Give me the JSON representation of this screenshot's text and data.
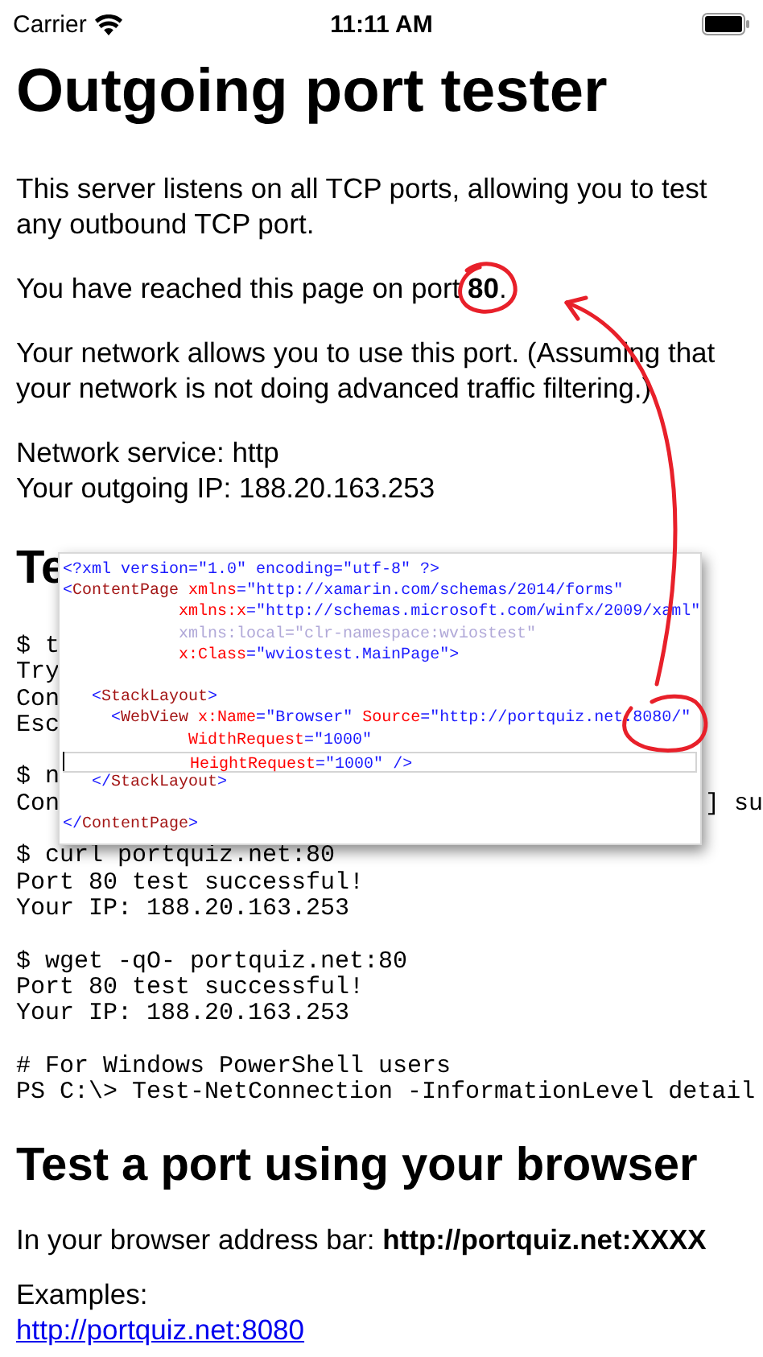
{
  "status_bar": {
    "carrier": "Carrier",
    "time": "11:11 AM"
  },
  "title": "Outgoing port tester",
  "intro": [
    "This server listens on all TCP ports, allowing you to test any outbound TCP port.",
    "You have reached this page on port **80**.",
    "Your network allows you to use this port. (Assuming that your network is not doing advanced traffic filtering.)"
  ],
  "info_lines": [
    "Network service: http",
    "Your outgoing IP: 188.20.163.253"
  ],
  "section_heading": "Te",
  "code_blocks": [
    [
      {
        "text": "$ t"
      },
      {
        "text": "Try"
      },
      {
        "text": "Con"
      },
      {
        "text": "Esc"
      }
    ],
    [
      {
        "text": "$ n"
      },
      {
        "text": "Con",
        "tail": "] su"
      }
    ],
    [
      {
        "text": "$ curl portquiz.net:80"
      },
      {
        "text": "Port 80 test successful!"
      },
      {
        "text": "Your IP: 188.20.163.253"
      }
    ],
    [
      {
        "text": "$ wget -qO- portquiz.net:80"
      },
      {
        "text": "Port 80 test successful!"
      },
      {
        "text": "Your IP: 188.20.163.253"
      }
    ],
    [
      {
        "text": "# For Windows PowerShell users"
      },
      {
        "text": "PS C:\\> Test-NetConnection -InformationLevel detail"
      }
    ]
  ],
  "browser_heading": "Test a port using your browser",
  "browser_hint": "In your browser address bar: **http://portquiz.net:XXXX**",
  "examples_label": "Examples:",
  "example_link": "http://portquiz.net:8080",
  "code_overlay": {
    "lines": [
      {
        "spaced": false,
        "current": false,
        "tokens": [
          {
            "kind": "punct",
            "text": "<?xml version=\"1.0\" encoding=\"utf-8\" ?>"
          }
        ]
      },
      {
        "spaced": false,
        "current": false,
        "tokens": [
          {
            "kind": "punct",
            "text": "<"
          },
          {
            "kind": "tag",
            "text": "ContentPage"
          },
          {
            "kind": "attr",
            "text": " xmlns"
          },
          {
            "kind": "punct",
            "text": "="
          },
          {
            "kind": "value",
            "text": "\"http://xamarin.com/schemas/2014/forms\""
          }
        ]
      },
      {
        "spaced": false,
        "current": false,
        "tokens": [
          {
            "kind": "attr",
            "text": "            xmlns:x"
          },
          {
            "kind": "punct",
            "text": "="
          },
          {
            "kind": "value",
            "text": "\"http://schemas.microsoft.com/winfx/2009/xaml\""
          }
        ]
      },
      {
        "spaced": false,
        "current": false,
        "tokens": [
          {
            "kind": "faded",
            "text": "            xmlns:local=\"clr-namespace:wviostest\""
          }
        ]
      },
      {
        "spaced": false,
        "current": false,
        "tokens": [
          {
            "kind": "attr",
            "text": "            x:Class"
          },
          {
            "kind": "punct",
            "text": "="
          },
          {
            "kind": "value",
            "text": "\"wviostest.MainPage\""
          },
          {
            "kind": "punct",
            "text": ">"
          }
        ]
      },
      {
        "spaced": true,
        "current": false,
        "tokens": [
          {
            "kind": "punct",
            "text": "   <"
          },
          {
            "kind": "tag",
            "text": "StackLayout"
          },
          {
            "kind": "punct",
            "text": ">"
          }
        ]
      },
      {
        "spaced": false,
        "current": false,
        "tokens": [
          {
            "kind": "punct",
            "text": "     <"
          },
          {
            "kind": "tag",
            "text": "WebView"
          },
          {
            "kind": "attr",
            "text": " x:Name"
          },
          {
            "kind": "punct",
            "text": "="
          },
          {
            "kind": "value",
            "text": "\"Browser\""
          },
          {
            "kind": "attr",
            "text": " Source"
          },
          {
            "kind": "punct",
            "text": "="
          },
          {
            "kind": "value",
            "text": "\"http://portquiz.net:8080/\""
          }
        ]
      },
      {
        "spaced": false,
        "current": false,
        "tokens": [
          {
            "kind": "attr",
            "text": "             WidthRequest"
          },
          {
            "kind": "punct",
            "text": "="
          },
          {
            "kind": "value",
            "text": "\"1000\""
          }
        ]
      },
      {
        "spaced": false,
        "current": true,
        "tokens": [
          {
            "kind": "attr",
            "text": "             HeightRequest"
          },
          {
            "kind": "punct",
            "text": "="
          },
          {
            "kind": "value",
            "text": "\"1000\""
          },
          {
            "kind": "punct",
            "text": " />"
          }
        ]
      },
      {
        "spaced": false,
        "current": false,
        "tokens": [
          {
            "kind": "punct",
            "text": "   </"
          },
          {
            "kind": "tag",
            "text": "StackLayout"
          },
          {
            "kind": "punct",
            "text": ">"
          }
        ]
      },
      {
        "spaced": true,
        "current": false,
        "tokens": [
          {
            "kind": "punct",
            "text": "</"
          },
          {
            "kind": "tag",
            "text": "ContentPage"
          },
          {
            "kind": "punct",
            "text": ">"
          }
        ]
      }
    ]
  }
}
